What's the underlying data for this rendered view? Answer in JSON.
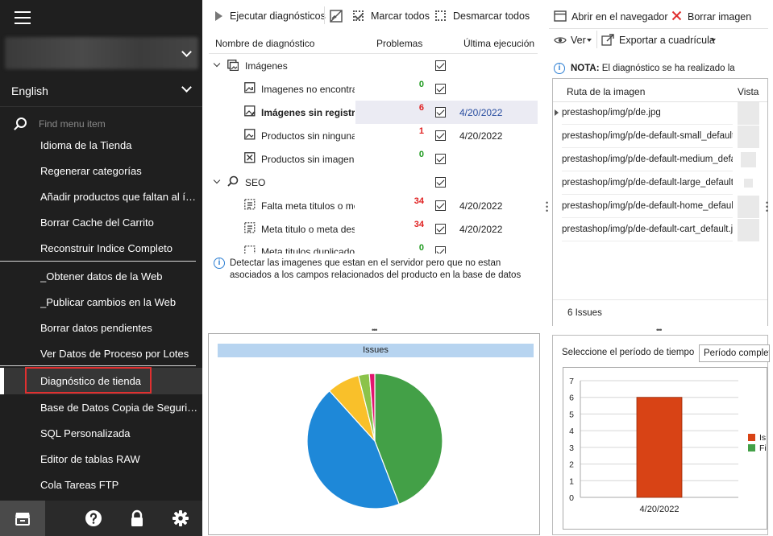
{
  "sidebar": {
    "language": "English",
    "search_placeholder": "Find menu item",
    "items": [
      {
        "label": "Idioma de la Tienda"
      },
      {
        "label": "Regenerar categorías"
      },
      {
        "label": "Añadir productos que faltan al índice de búsqueda"
      },
      {
        "label": "Borrar Cache del Carrito"
      },
      {
        "label": "Reconstruir Indice Completo"
      },
      {
        "label": "_Obtener datos de la Web"
      },
      {
        "label": "_Publicar cambios en la Web"
      },
      {
        "label": "Borrar datos pendientes"
      },
      {
        "label": "Ver Datos de Proceso por Lotes"
      },
      {
        "label": "Diagnóstico de tienda"
      },
      {
        "label": "Base de Datos Copia de Seguridad"
      },
      {
        "label": "SQL Personalizada"
      },
      {
        "label": "Editor de tablas RAW"
      },
      {
        "label": "Cola Tareas FTP"
      }
    ],
    "bottom_icons": [
      "store-icon",
      "help-icon",
      "lock-icon",
      "gear-icon"
    ]
  },
  "toolbar": {
    "run_label": "Ejecutar diagnósticos",
    "mark_all": "Marcar todos",
    "unmark_all": "Desmarcar todos"
  },
  "diagnostics": {
    "columns": [
      "Nombre de diagnóstico",
      "Problemas",
      "Última ejecución"
    ],
    "groups": [
      {
        "name": "Imágenes",
        "items": [
          {
            "name": "Imagenes no encontradas",
            "problems": "0",
            "date": ""
          },
          {
            "name": "Imágenes sin registros",
            "problems": "6",
            "date": "4/20/2022"
          },
          {
            "name": "Productos sin ninguna imagen",
            "problems": "1",
            "date": "4/20/2022"
          },
          {
            "name": "Productos sin imagen",
            "problems": "0",
            "date": ""
          }
        ]
      },
      {
        "name": "SEO",
        "items": [
          {
            "name": "Falta meta titulos o meta descripciones",
            "problems": "34",
            "date": "4/20/2022"
          },
          {
            "name": "Meta titulo o meta descripcion",
            "problems": "34",
            "date": "4/20/2022"
          },
          {
            "name": "Meta titulos duplicados",
            "problems": "0",
            "date": ""
          }
        ]
      }
    ],
    "description": "Detectar las imagenes que estan en el servidor pero que no estan asociados a los campos relacionados del producto en la base de datos"
  },
  "pie_chart": {
    "chart_data": {
      "type": "pie",
      "title": "Issues",
      "values": [
        34,
        34,
        6,
        2,
        1
      ],
      "colors": [
        "#43a047",
        "#1e88d8",
        "#f9c02a",
        "#8bc34a",
        "#e2156e"
      ]
    }
  },
  "right_panel": {
    "open_browser": "Abrir en el navegador",
    "delete_image": "Borrar imagen",
    "view": "Ver",
    "export": "Exportar a cuadrícula",
    "note_bold": "NOTA:",
    "note_text": "El diagnóstico se ha realizado la",
    "columns": [
      "Ruta de la imagen",
      "Vista"
    ],
    "rows": [
      "prestashop/img/p/de.jpg",
      "prestashop/img/p/de-default-small_default.jpg",
      "prestashop/img/p/de-default-medium_default.jpg",
      "prestashop/img/p/de-default-large_default.jpg",
      "prestashop/img/p/de-default-home_default.jpg",
      "prestashop/img/p/de-default-cart_default.jpg"
    ],
    "footer": "6 Issues",
    "period_label": "Seleccione el período de tiempo",
    "period_value": "Período completo"
  },
  "bar_chart": {
    "chart_data": {
      "type": "bar",
      "categories": [
        "4/20/2022"
      ],
      "values": [
        6
      ],
      "ylim": [
        0,
        7
      ],
      "yticks": [
        "0",
        "1",
        "2",
        "3",
        "4",
        "5",
        "6",
        "7"
      ],
      "legend": [
        "Is",
        "Fi"
      ],
      "colors": [
        "#d84315",
        "#43a047"
      ]
    }
  }
}
